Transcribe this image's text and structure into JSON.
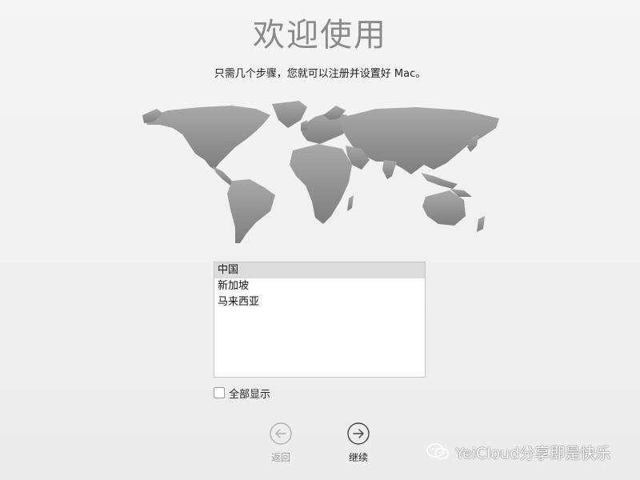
{
  "header": {
    "title": "欢迎使用",
    "subtitle": "只需几个步骤，您就可以注册并设置好 Mac。"
  },
  "regions": {
    "items": [
      "中国",
      "新加坡",
      "马来西亚"
    ],
    "selected": "中国"
  },
  "show_all": {
    "label": "全部显示",
    "checked": false
  },
  "navigation": {
    "back_label": "返回",
    "continue_label": "继续"
  },
  "watermark": {
    "text": "YeiCloud分享即是快乐",
    "icon": "wechat-icon"
  },
  "colors": {
    "map": "#8f8f8f",
    "selection": "#dcdcdc",
    "disabled": "#a8a8a8"
  }
}
